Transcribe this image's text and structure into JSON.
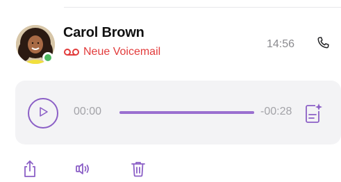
{
  "contact": {
    "name": "Carol Brown",
    "status_text": "Neue Voicemail",
    "time": "14:56",
    "presence": "online"
  },
  "player": {
    "elapsed": "00:00",
    "remaining": "-00:28",
    "progress_fraction": 1.0
  },
  "icons": {
    "voicemail": "voicemail-icon",
    "call": "phone-icon",
    "play": "play-icon",
    "transcript": "transcript-icon",
    "share": "share-icon",
    "speaker": "speaker-icon",
    "delete": "trash-icon"
  },
  "colors": {
    "accent": "#8b5fc6",
    "accent_light": "#d9cdea",
    "voicemail_red": "#e23b3b",
    "presence_green": "#4cb860",
    "muted_text": "#8a8a8e",
    "player_bg": "#f3f3f5"
  }
}
